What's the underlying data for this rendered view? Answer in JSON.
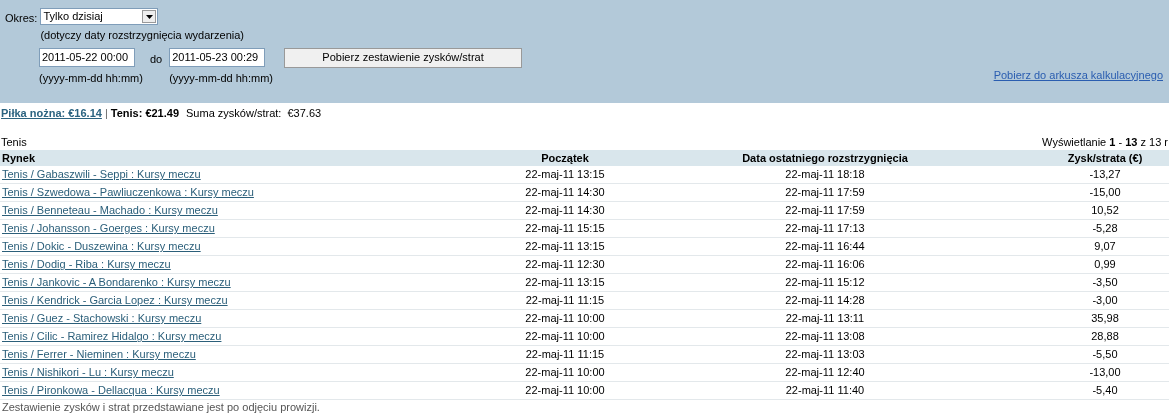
{
  "filter": {
    "period_label": "Okres:",
    "period_value": "Tylko dzisiaj",
    "period_note": "(dotyczy daty rozstrzygnięcia wydarzenia)",
    "from": {
      "value": "2011-05-22 00:00",
      "hint": "(yyyy-mm-dd hh:mm)"
    },
    "to_label": "do",
    "to": {
      "value": "2011-05-23 00:29",
      "hint": "(yyyy-mm-dd hh:mm)"
    },
    "submit": "Pobierz zestawienie zysków/strat",
    "export_link": "Pobierz do arkusza kalkulacyjnego"
  },
  "summary": {
    "link": "Piłka nożna: €16.14",
    "separator": "|",
    "current": "Tenis: €21.49",
    "total": "Suma zysków/strat:  €37.63"
  },
  "section_title": "Tenis",
  "paging": "Wyświetlanie **1** - **13** z 13 r",
  "table": {
    "columns": [
      "Rynek",
      "Początek",
      "Data ostatniego rozstrzygnięcia",
      "Zysk/strata (€)"
    ],
    "rows": [
      [
        "Tenis / Gabaszwili - Seppi : Kursy meczu",
        "22-maj-11 13:15",
        "22-maj-11 18:18",
        "-13,27"
      ],
      [
        "Tenis / Szwedowa - Pawliuczenkowa : Kursy meczu",
        "22-maj-11 14:30",
        "22-maj-11 17:59",
        "-15,00"
      ],
      [
        "Tenis / Benneteau - Machado : Kursy meczu",
        "22-maj-11 14:30",
        "22-maj-11 17:59",
        "10,52"
      ],
      [
        "Tenis / Johansson - Goerges : Kursy meczu",
        "22-maj-11 15:15",
        "22-maj-11 17:13",
        "-5,28"
      ],
      [
        "Tenis / Dokic - Duszewina : Kursy meczu",
        "22-maj-11 13:15",
        "22-maj-11 16:44",
        "9,07"
      ],
      [
        "Tenis / Dodig - Riba : Kursy meczu",
        "22-maj-11 12:30",
        "22-maj-11 16:06",
        "0,99"
      ],
      [
        "Tenis / Jankovic - A Bondarenko : Kursy meczu",
        "22-maj-11 13:15",
        "22-maj-11 15:12",
        "-3,50"
      ],
      [
        "Tenis / Kendrick - Garcia Lopez : Kursy meczu",
        "22-maj-11 11:15",
        "22-maj-11 14:28",
        "-3,00"
      ],
      [
        "Tenis / Guez - Stachowski : Kursy meczu",
        "22-maj-11 10:00",
        "22-maj-11 13:11",
        "35,98"
      ],
      [
        "Tenis / Cilic - Ramirez Hidalgo : Kursy meczu",
        "22-maj-11 10:00",
        "22-maj-11 13:08",
        "28,88"
      ],
      [
        "Tenis / Ferrer - Nieminen : Kursy meczu",
        "22-maj-11 11:15",
        "22-maj-11 13:03",
        "-5,50"
      ],
      [
        "Tenis / Nishikori - Lu : Kursy meczu",
        "22-maj-11 10:00",
        "22-maj-11 12:40",
        "-13,00"
      ],
      [
        "Tenis / Pironkowa - Dellacqua : Kursy meczu",
        "22-maj-11 10:00",
        "22-maj-11 11:40",
        "-5,40"
      ]
    ]
  },
  "footer_note": "Zestawienie zysków i strat przedstawiane jest po odjęciu prowizji."
}
